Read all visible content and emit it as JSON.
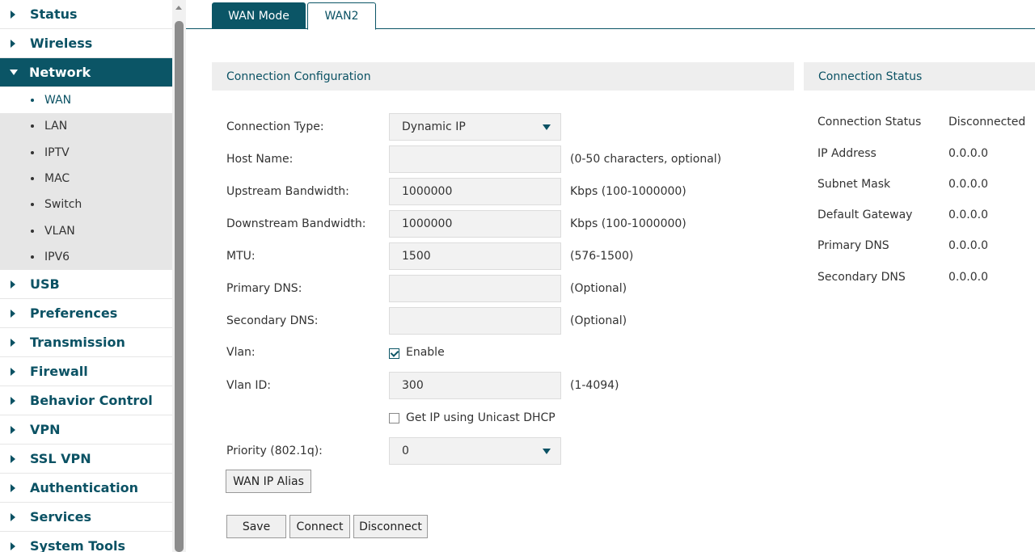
{
  "sidebar": {
    "items": [
      {
        "label": "Status"
      },
      {
        "label": "Wireless"
      },
      {
        "label": "Network"
      },
      {
        "label": "USB"
      },
      {
        "label": "Preferences"
      },
      {
        "label": "Transmission"
      },
      {
        "label": "Firewall"
      },
      {
        "label": "Behavior Control"
      },
      {
        "label": "VPN"
      },
      {
        "label": "SSL VPN"
      },
      {
        "label": "Authentication"
      },
      {
        "label": "Services"
      },
      {
        "label": "System Tools"
      }
    ],
    "network_sub": [
      "WAN",
      "LAN",
      "IPTV",
      "MAC",
      "Switch",
      "VLAN",
      "IPV6"
    ]
  },
  "tabs": {
    "wan_mode": "WAN Mode",
    "wan2": "WAN2"
  },
  "config": {
    "title": "Connection Configuration",
    "connection_type_label": "Connection Type:",
    "connection_type_value": "Dynamic IP",
    "host_name_label": "Host Name:",
    "host_name_value": "",
    "host_name_hint": "(0-50 characters, optional)",
    "upstream_label": "Upstream Bandwidth:",
    "upstream_value": "1000000",
    "upstream_hint": "Kbps (100-1000000)",
    "downstream_label": "Downstream Bandwidth:",
    "downstream_value": "1000000",
    "downstream_hint": "Kbps (100-1000000)",
    "mtu_label": "MTU:",
    "mtu_value": "1500",
    "mtu_hint": "(576-1500)",
    "primary_dns_label": "Primary DNS:",
    "primary_dns_value": "",
    "primary_dns_hint": "(Optional)",
    "secondary_dns_label": "Secondary DNS:",
    "secondary_dns_value": "",
    "secondary_dns_hint": "(Optional)",
    "vlan_label": "Vlan:",
    "vlan_enable_label": "Enable",
    "vlan_id_label": "Vlan ID:",
    "vlan_id_value": "300",
    "vlan_id_hint": "(1-4094)",
    "unicast_dhcp_label": "Get IP using Unicast DHCP",
    "priority_label": "Priority (802.1q):",
    "priority_value": "0",
    "wan_ip_alias_label": "WAN IP Alias",
    "save_label": "Save",
    "connect_label": "Connect",
    "disconnect_label": "Disconnect"
  },
  "status": {
    "title": "Connection Status",
    "rows": [
      {
        "label": "Connection Status",
        "value": "Disconnected"
      },
      {
        "label": "IP Address",
        "value": "0.0.0.0"
      },
      {
        "label": "Subnet Mask",
        "value": "0.0.0.0"
      },
      {
        "label": "Default Gateway",
        "value": "0.0.0.0"
      },
      {
        "label": "Primary DNS",
        "value": "0.0.0.0"
      },
      {
        "label": "Secondary DNS",
        "value": "0.0.0.0"
      }
    ]
  }
}
